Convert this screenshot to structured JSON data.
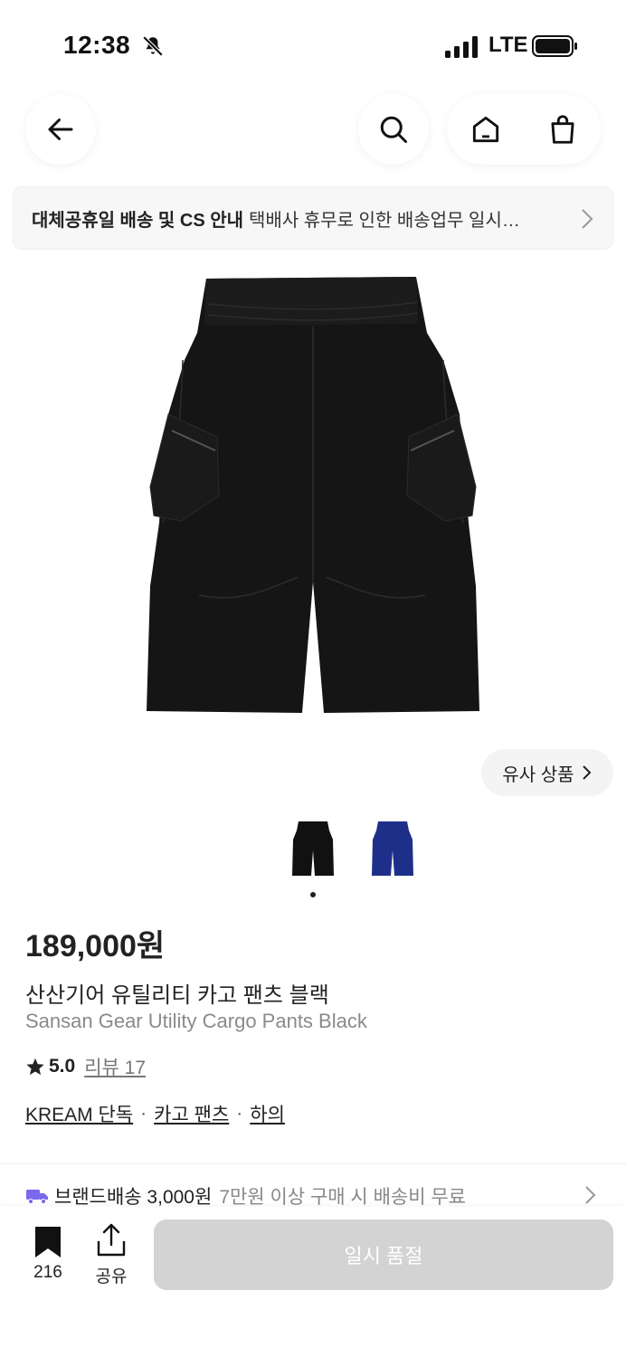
{
  "status": {
    "time": "12:38",
    "network": "LTE"
  },
  "notice": {
    "title": "대체공휴일 배송 및 CS 안내",
    "text": "택배사 휴무로 인한 배송업무 일시…"
  },
  "similar": {
    "label": "유사 상품"
  },
  "thumbnails": [
    {
      "name": "black",
      "color": "#111111"
    },
    {
      "name": "blue",
      "color": "#1e2f8a"
    }
  ],
  "product": {
    "price": "189,000원",
    "name_ko": "산산기어 유틸리티 카고 팬츠 블랙",
    "name_en": "Sansan Gear Utility Cargo Pants Black",
    "rating": "5.0",
    "review_label": "리뷰 17",
    "categories": [
      "KREAM 단독",
      "카고 팬츠",
      "하의"
    ],
    "category_separator": "·"
  },
  "shipping": {
    "label": "브랜드배송 3,000원",
    "sub": "7만원 이상 구매 시 배송비 무료"
  },
  "bottom": {
    "bookmark_count": "216",
    "share_label": "공유",
    "cta_label": "일시 품절"
  },
  "colors": {
    "accent_purple": "#7b68ee",
    "disabled_cta": "#d3d3d3"
  }
}
